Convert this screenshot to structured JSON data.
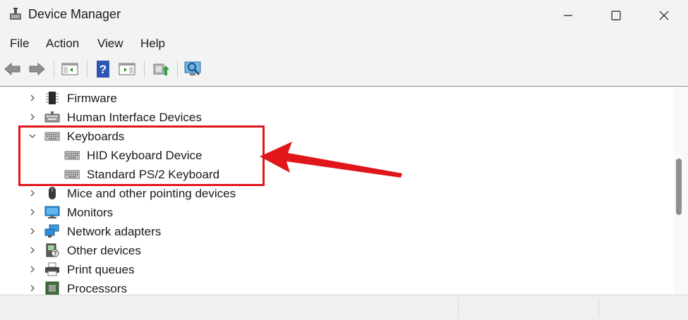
{
  "window": {
    "title": "Device Manager",
    "icon": "device-manager-icon",
    "controls": [
      "minimize-icon",
      "maximize-icon",
      "close-icon"
    ]
  },
  "menu": [
    "File",
    "Action",
    "View",
    "Help"
  ],
  "toolbar": {
    "buttons": [
      "back-arrow-icon",
      "forward-arrow-icon",
      "properties-pane-icon",
      "help-icon",
      "show-hide-pane-icon",
      "update-driver-icon",
      "scan-hardware-icon"
    ]
  },
  "tree": {
    "firmware": "Firmware",
    "hid": "Human Interface Devices",
    "keyboards": "Keyboards",
    "hid_keyboard": "HID Keyboard Device",
    "ps2_keyboard": "Standard PS/2 Keyboard",
    "mice": "Mice and other pointing devices",
    "monitors": "Monitors",
    "network": "Network adapters",
    "other": "Other devices",
    "print": "Print queues",
    "processors": "Processors"
  },
  "colors": {
    "annotation_red": "#e0161b",
    "window_bg": "#f3f3f3",
    "content_bg": "#ffffff"
  }
}
